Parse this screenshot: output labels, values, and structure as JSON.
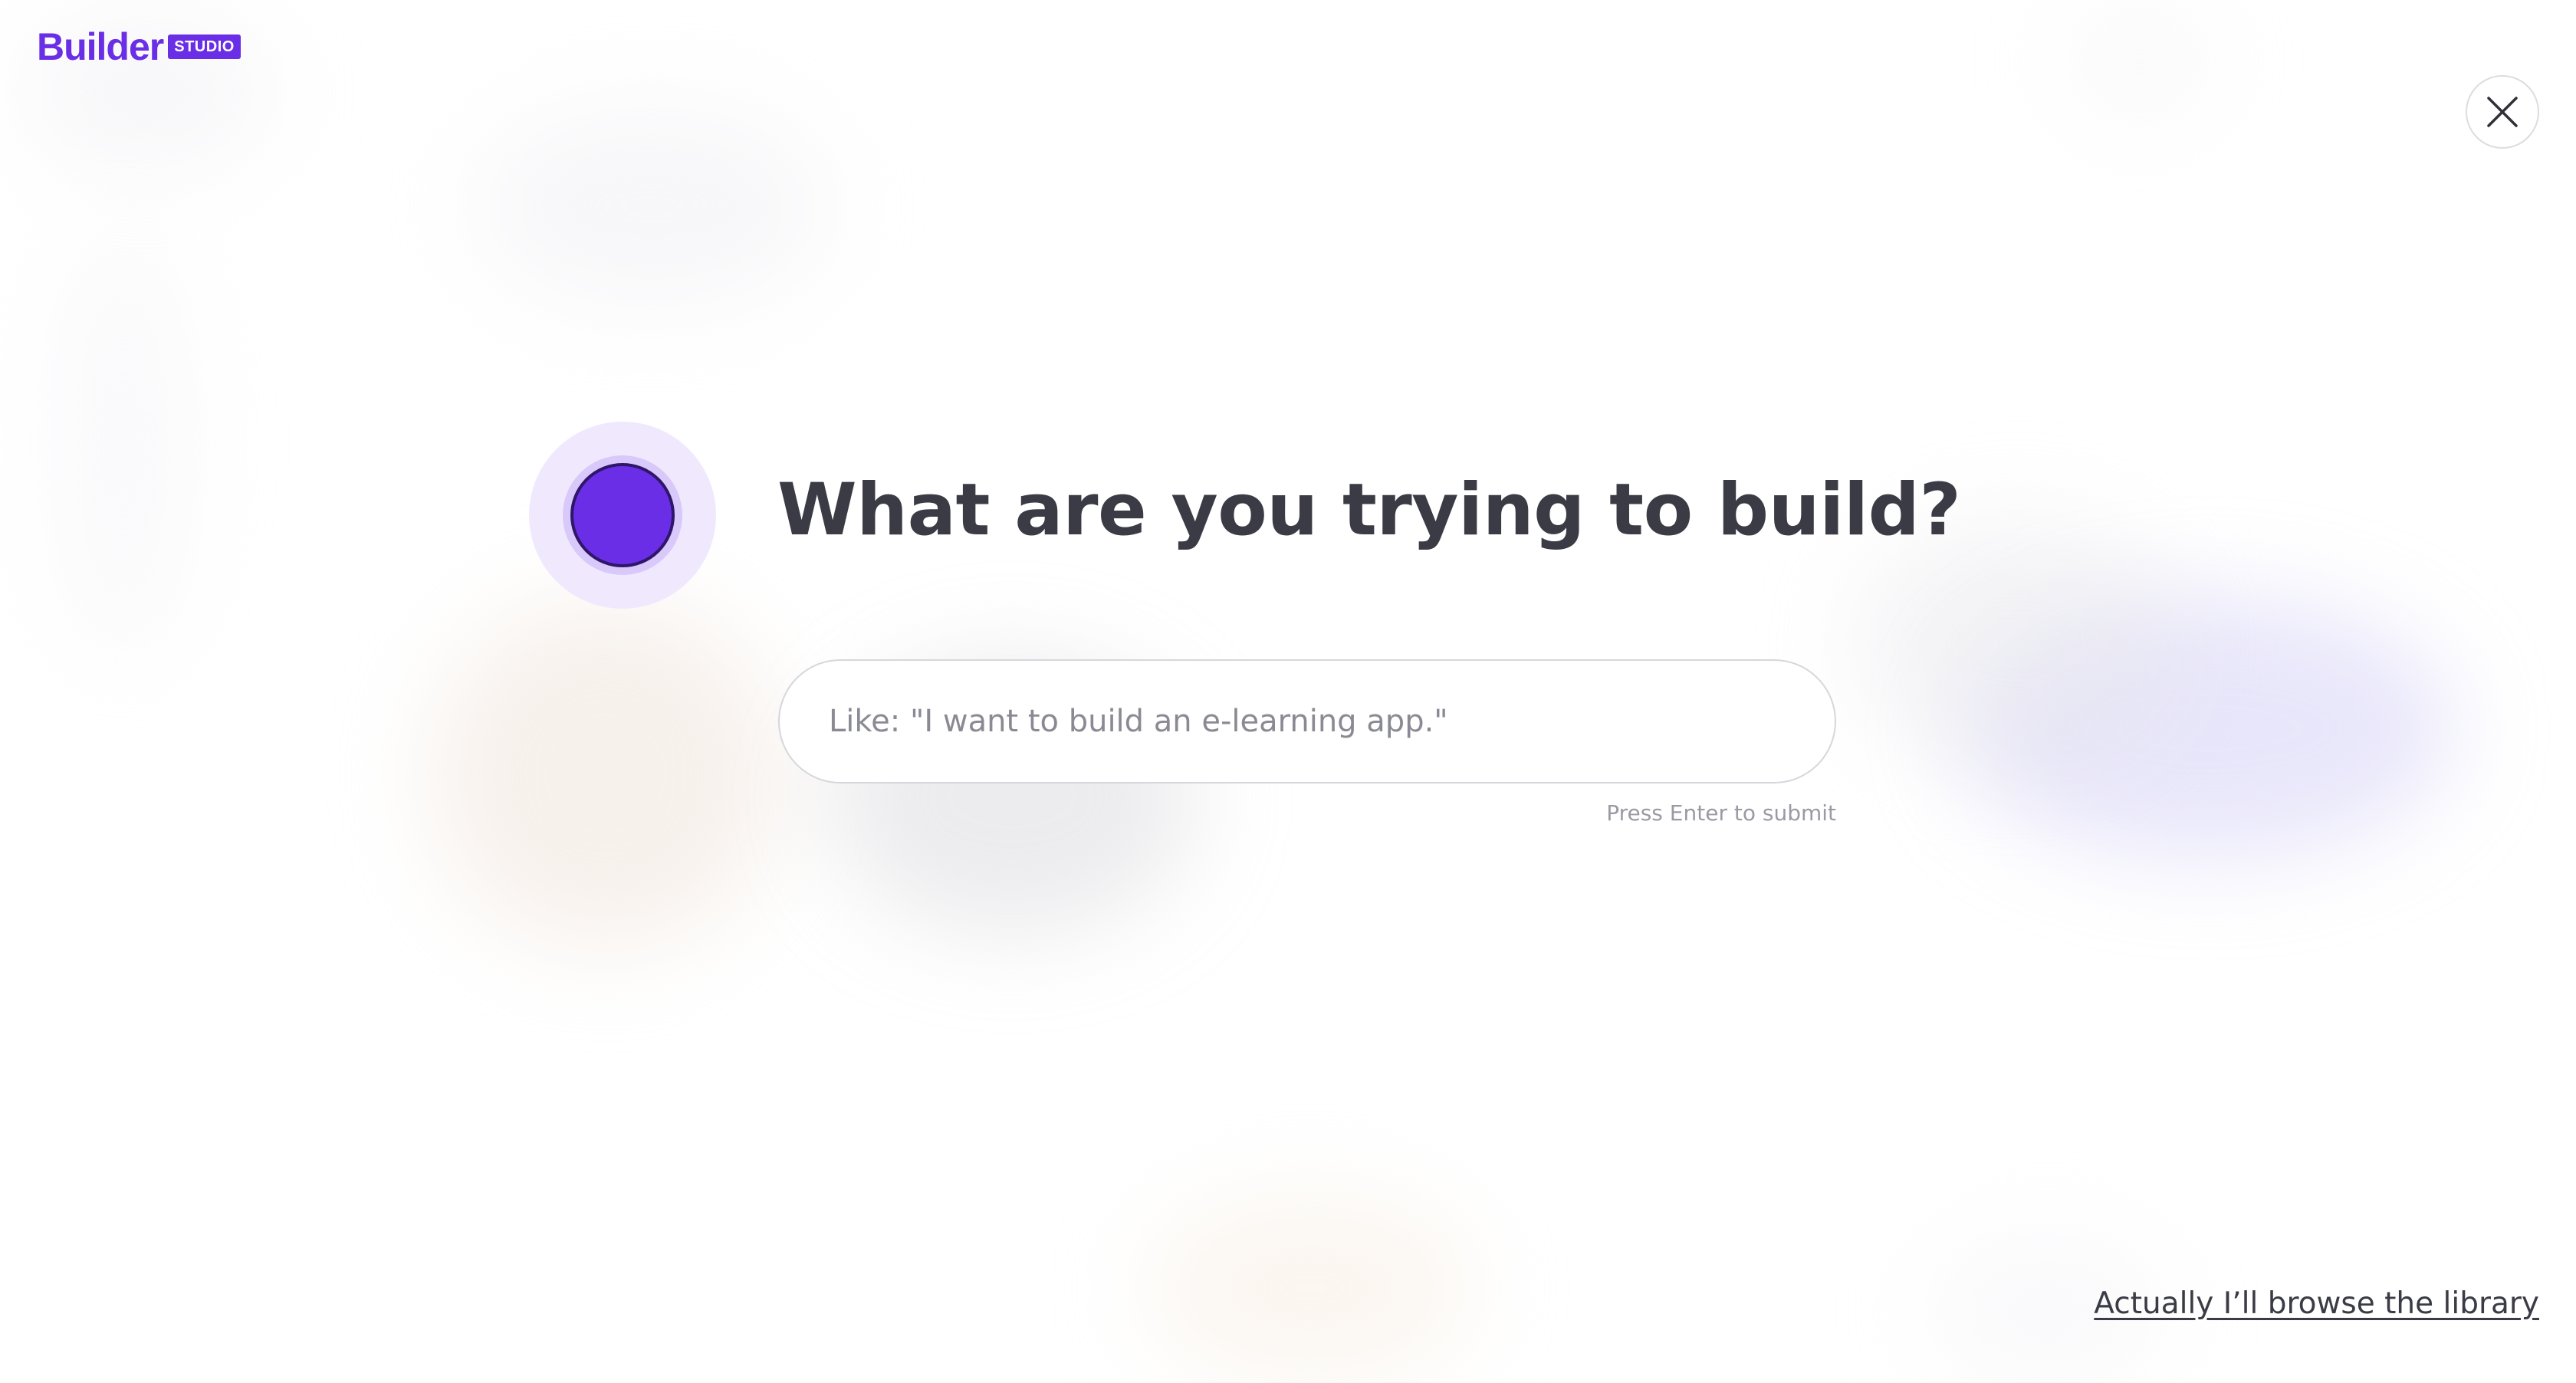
{
  "logo": {
    "word": "Builder",
    "badge": "STUDIO"
  },
  "main": {
    "heading": "What are you trying to build?",
    "input_value": "",
    "input_placeholder": "Like: \"I want to build an e-learning app.\"",
    "hint": "Press Enter to submit"
  },
  "footer": {
    "browse_link": "Actually I’ll browse the library"
  },
  "icons": {
    "close": "close-icon",
    "orb": "assistant-orb-icon"
  },
  "colors": {
    "brand": "#6a2ee6",
    "heading": "#3b3b45",
    "placeholder": "#8a8a94",
    "hint": "#9a9aa4"
  }
}
